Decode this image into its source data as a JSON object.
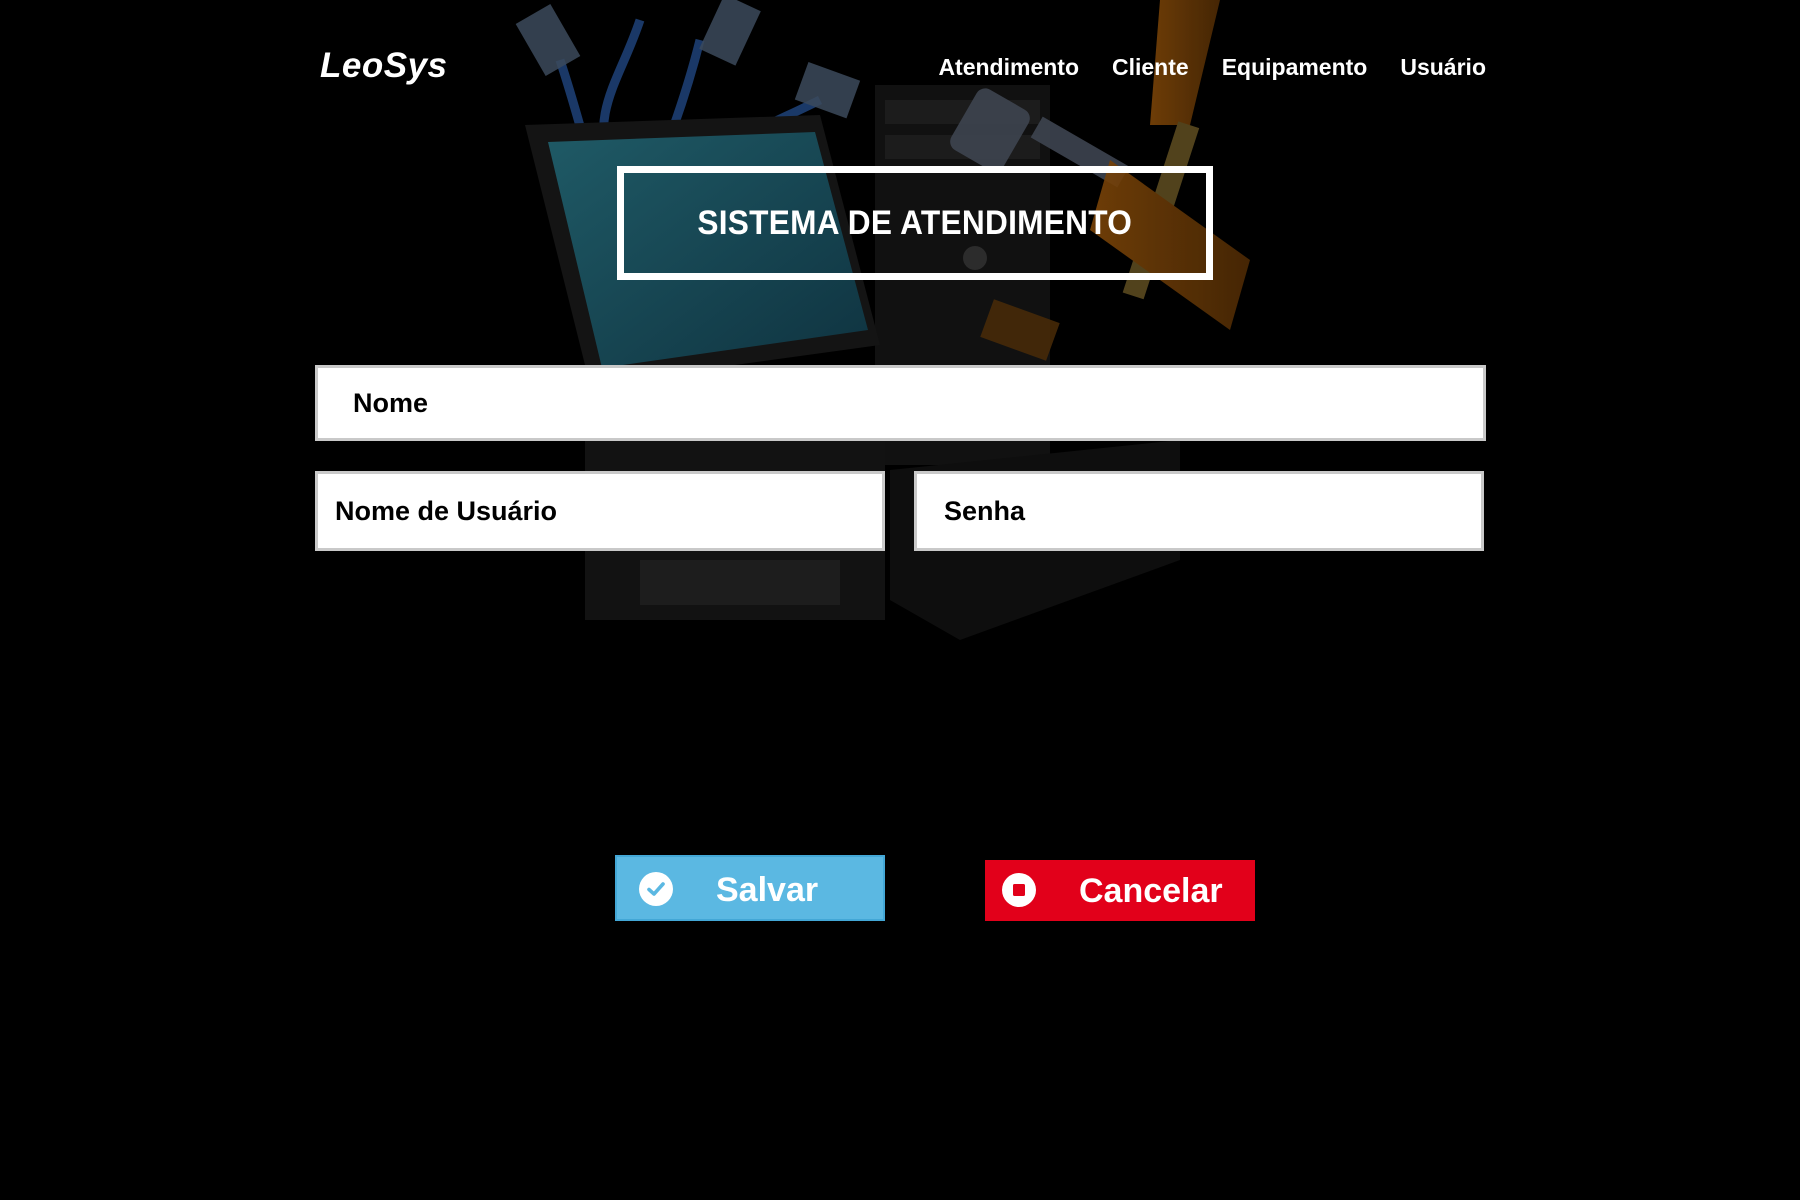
{
  "brand": {
    "logo": "LeoSys"
  },
  "nav": {
    "items": [
      {
        "label": "Atendimento"
      },
      {
        "label": "Cliente"
      },
      {
        "label": "Equipamento"
      },
      {
        "label": "Usuário"
      }
    ]
  },
  "hero": {
    "title": "SISTEMA DE ATENDIMENTO"
  },
  "form": {
    "name_placeholder": "Nome",
    "username_placeholder": "Nome de Usuário",
    "password_placeholder": "Senha"
  },
  "actions": {
    "save_label": "Salvar",
    "cancel_label": "Cancelar"
  },
  "icons": {
    "save": "check-circle-icon",
    "cancel": "stop-circle-icon"
  },
  "colors": {
    "background": "#000000",
    "save_button": "#5bb8e2",
    "cancel_button": "#e2001a",
    "text": "#ffffff"
  }
}
